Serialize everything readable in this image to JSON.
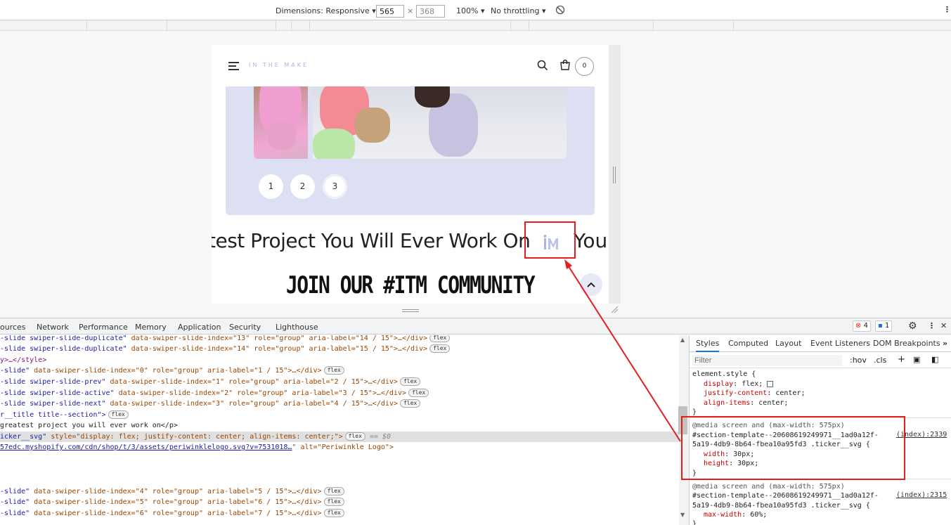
{
  "device_toolbar": {
    "dimensions_label": "Dimensions: Responsive",
    "width": "565",
    "times": "×",
    "height": "368",
    "zoom": "100%",
    "throttling": "No throttling"
  },
  "site": {
    "logo": "IN THE MAKE",
    "cart_count": "0",
    "pager": [
      "1",
      "2",
      "3"
    ],
    "pager_active": "3",
    "ticker_text": "test Project You Will Ever Work On",
    "ticker_after": "You",
    "ticker_logo": "IM",
    "community_heading": "JOIN OUR #ITM COMMUNITY",
    "up_arrow": "⌃"
  },
  "devtools": {
    "tabs": [
      "ources",
      "Network",
      "Performance",
      "Memory",
      "Application",
      "Security",
      "Lighthouse"
    ],
    "errors": "4",
    "messages": "1",
    "styles_tabs": [
      "Styles",
      "Computed",
      "Layout",
      "Event Listeners",
      "DOM Breakpoints"
    ],
    "filter_placeholder": "Filter",
    "hov": ":hov",
    "cls": ".cls",
    "elements_lines": [
      {
        "pre": "-slide swiper-slide-duplicate\"",
        "attrs": " data-swiper-slide-index=\"13\" role=\"group\" aria-label=\"14 / 15\">…</div>",
        "flex": "flex"
      },
      {
        "pre": "-slide swiper-slide-duplicate\"",
        "attrs": " data-swiper-slide-index=\"14\" role=\"group\" aria-label=\"15 / 15\">…</div>",
        "flex": "flex"
      },
      {
        "pre": "y>…</style>",
        "attrs": "",
        "flex": ""
      },
      {
        "pre": "-slide\"",
        "attrs": " data-swiper-slide-index=\"0\" role=\"group\" aria-label=\"1 / 15\">…</div>",
        "flex": "flex"
      },
      {
        "pre": "-slide swiper-slide-prev\"",
        "attrs": " data-swiper-slide-index=\"1\" role=\"group\" aria-label=\"2 / 15\">…</div>",
        "flex": "flex"
      },
      {
        "pre": "-slide swiper-slide-active\"",
        "attrs": " data-swiper-slide-index=\"2\" role=\"group\" aria-label=\"3 / 15\">…</div>",
        "flex": "flex"
      },
      {
        "pre": "-slide swiper-slide-next\"",
        "attrs": " data-swiper-slide-index=\"3\" role=\"group\" aria-label=\"4 / 15\">…</div>",
        "flex": "flex"
      },
      {
        "pre": "r__title title--section\">",
        "attrs": "",
        "flex": "flex"
      },
      {
        "pre": " greatest project you will ever work on</p>",
        "attrs": "",
        "flex": ""
      },
      {
        "pre": "icker__svg\"",
        "attrs": " style=\"display: flex; justify-content: center; align-items: center;\">",
        "flex": "flex",
        "tail": " == $0"
      },
      {
        "pre": "57edc.myshopify.com/cdn/shop/t/3/assets/periwinklelogo.svg?v=7531018…",
        "attrs": "\" alt=\"Periwinkle Logo\">",
        "flex": ""
      },
      {
        "pre": "",
        "attrs": "",
        "flex": ""
      },
      {
        "pre": "",
        "attrs": "",
        "flex": ""
      },
      {
        "pre": "",
        "attrs": "",
        "flex": ""
      },
      {
        "pre": "-slide\"",
        "attrs": " data-swiper-slide-index=\"4\" role=\"group\" aria-label=\"5 / 15\">…</div>",
        "flex": "flex"
      },
      {
        "pre": "-slide\"",
        "attrs": " data-swiper-slide-index=\"5\" role=\"group\" aria-label=\"6 / 15\">…</div>",
        "flex": "flex"
      },
      {
        "pre": "-slide\"",
        "attrs": " data-swiper-slide-index=\"6\" role=\"group\" aria-label=\"7 / 15\">…</div>",
        "flex": "flex"
      }
    ],
    "css_rules": {
      "element_style": "element.style {",
      "es_lines": [
        "display: flex;",
        "justify-content: center;",
        "align-items: center;"
      ],
      "media1": "@media screen and (max-width: 575px)",
      "sel1a": "#section-template--20608619249971__1ad0a12f-",
      "sel1b": "5a19-4db9-8b64-fbea10a95fd3 .ticker__svg {",
      "src1": "(index):2339",
      "r1_lines": [
        "width: 30px;",
        "height: 30px;"
      ],
      "media2": "@media screen and (max-width: 575px)",
      "sel2a": "#section-template--20608619249971__1ad0a12f-",
      "sel2b": "5a19-4db9-8b64-fbea10a95fd3 .ticker__svg {",
      "src2": "(index):2315",
      "r2_lines": [
        "max-width: 60%;"
      ],
      "close": "}"
    }
  },
  "colors": {
    "highlight": "#e41e1e",
    "slider_bg": "#dde0f3",
    "logo": "#a8b4e3"
  }
}
